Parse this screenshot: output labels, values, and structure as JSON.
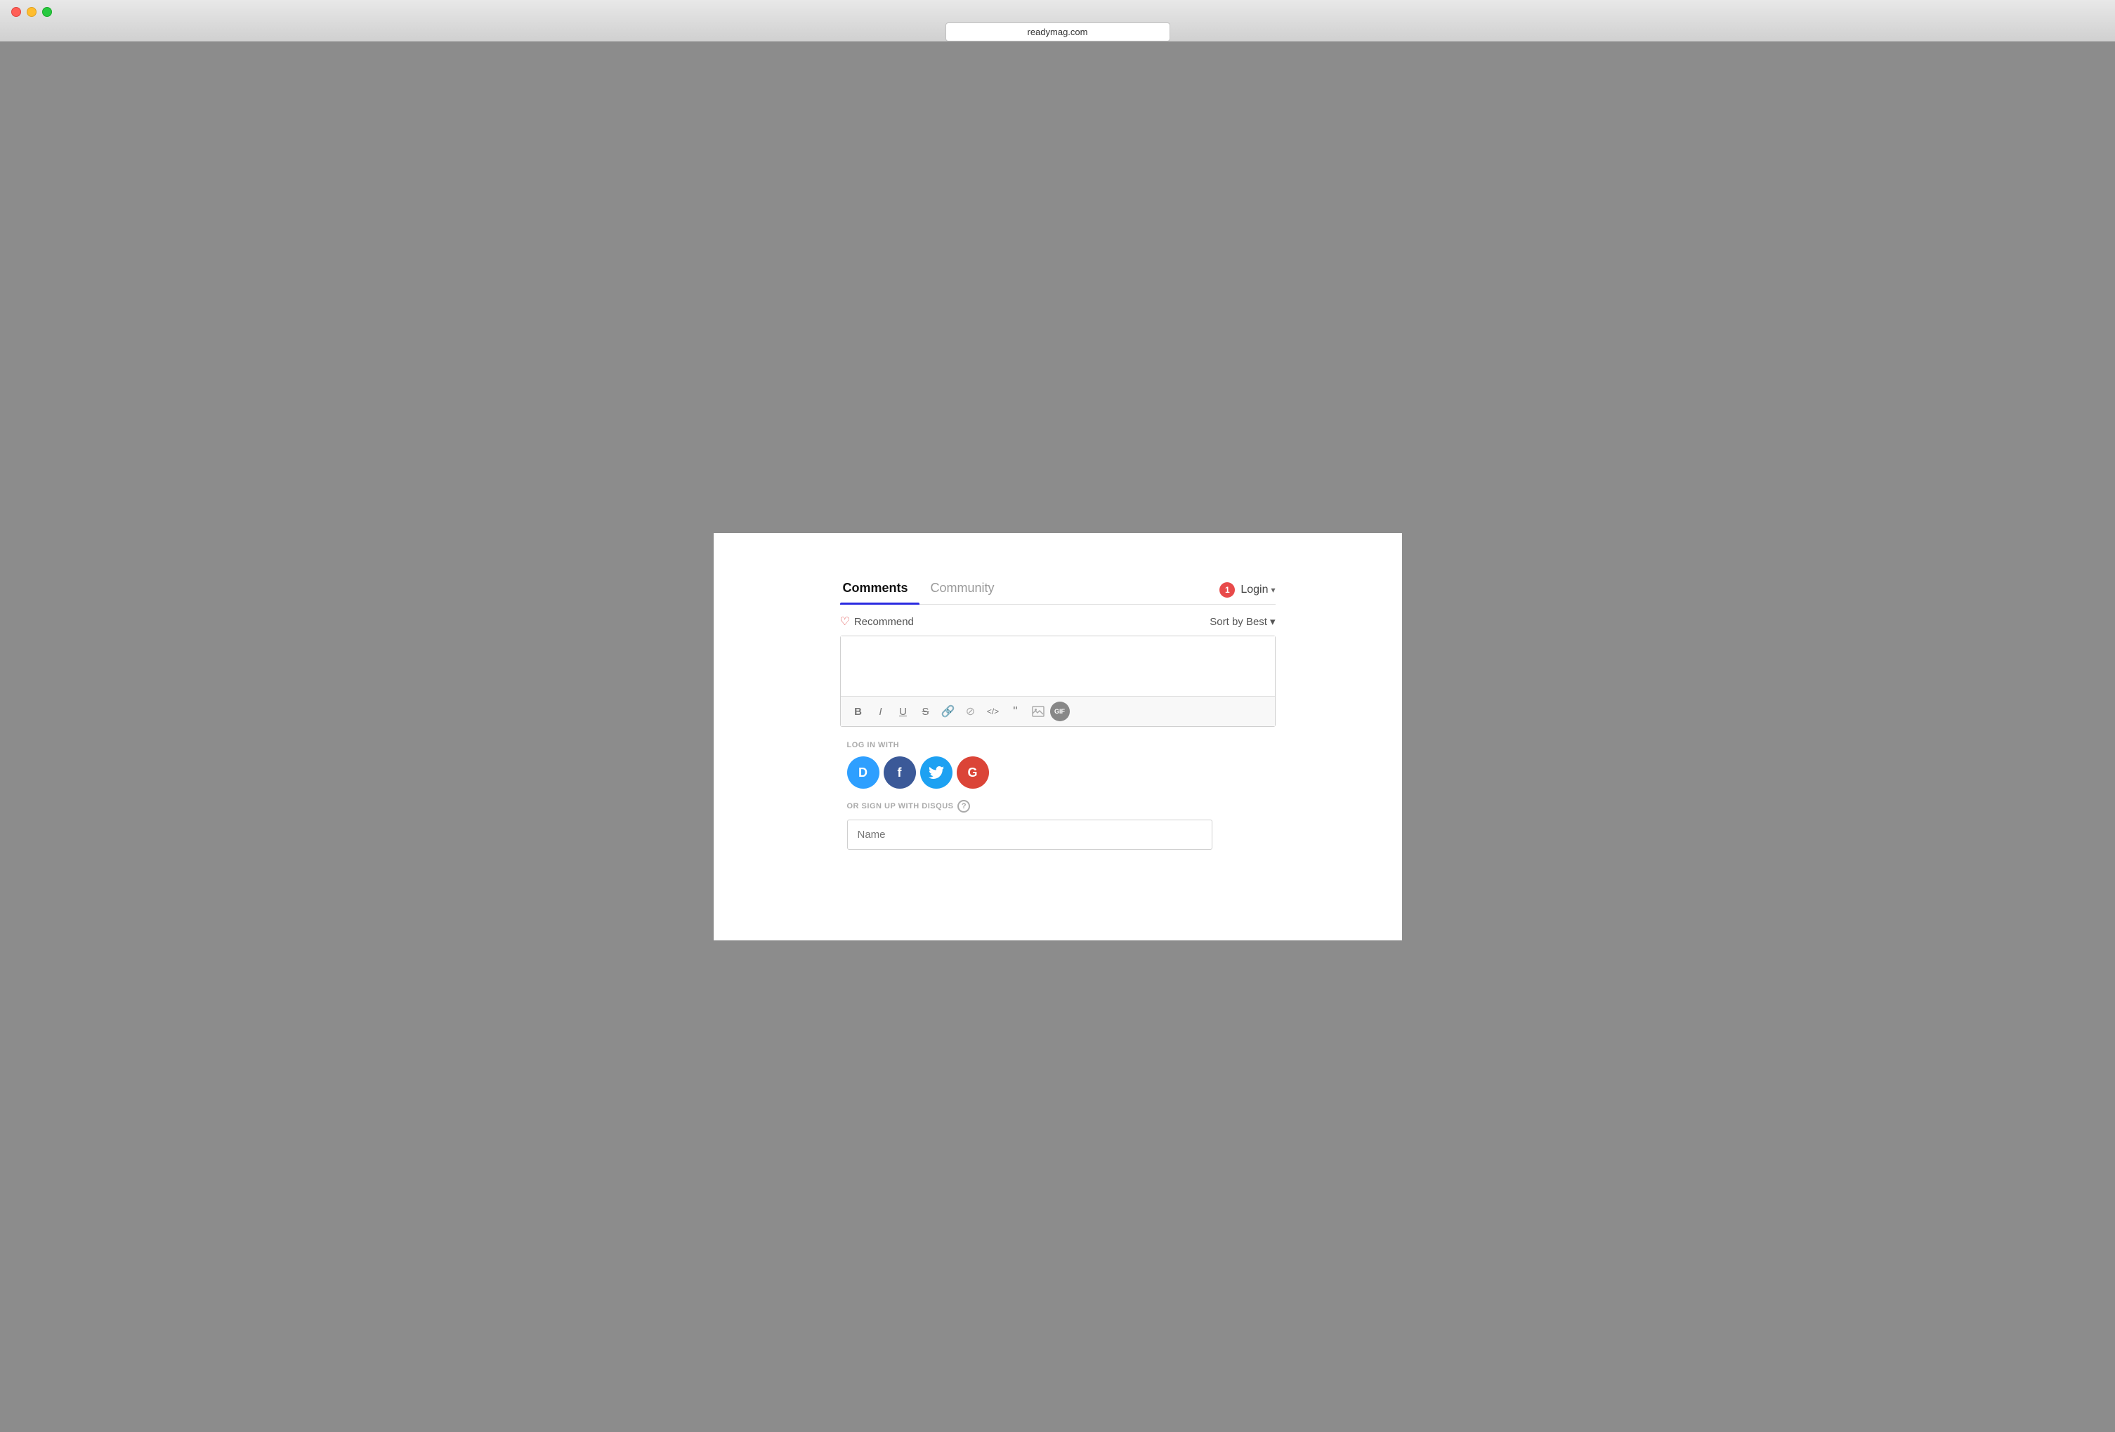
{
  "browser": {
    "url": "readymag.com",
    "traffic_lights": [
      "close",
      "minimize",
      "maximize"
    ]
  },
  "tabs": [
    {
      "id": "comments",
      "label": "Comments",
      "active": true
    },
    {
      "id": "community",
      "label": "Community",
      "active": false
    }
  ],
  "login": {
    "badge": "1",
    "label": "Login",
    "chevron": "▾"
  },
  "actions": {
    "recommend_label": "Recommend",
    "sort_label": "Sort by Best",
    "sort_chevron": "▾"
  },
  "editor": {
    "placeholder": "",
    "toolbar": [
      {
        "id": "bold",
        "label": "B",
        "title": "Bold"
      },
      {
        "id": "italic",
        "label": "I",
        "title": "Italic"
      },
      {
        "id": "underline",
        "label": "U",
        "title": "Underline"
      },
      {
        "id": "strikethrough",
        "label": "S",
        "title": "Strikethrough"
      },
      {
        "id": "link",
        "label": "🔗",
        "title": "Link"
      },
      {
        "id": "block-link",
        "label": "⊘",
        "title": "Block URL"
      },
      {
        "id": "code",
        "label": "</>",
        "title": "Code"
      },
      {
        "id": "blockquote",
        "label": "❝",
        "title": "Blockquote"
      },
      {
        "id": "image",
        "label": "🖼",
        "title": "Image"
      },
      {
        "id": "gif",
        "label": "GIF",
        "title": "GIF"
      }
    ]
  },
  "login_section": {
    "log_in_with_label": "LOG IN WITH",
    "social_buttons": [
      {
        "id": "disqus",
        "label": "D",
        "title": "Disqus"
      },
      {
        "id": "facebook",
        "label": "f",
        "title": "Facebook"
      },
      {
        "id": "twitter",
        "label": "t",
        "title": "Twitter"
      },
      {
        "id": "google",
        "label": "G",
        "title": "Google"
      }
    ],
    "or_signup_label": "OR SIGN UP WITH DISQUS",
    "name_placeholder": "Name"
  }
}
